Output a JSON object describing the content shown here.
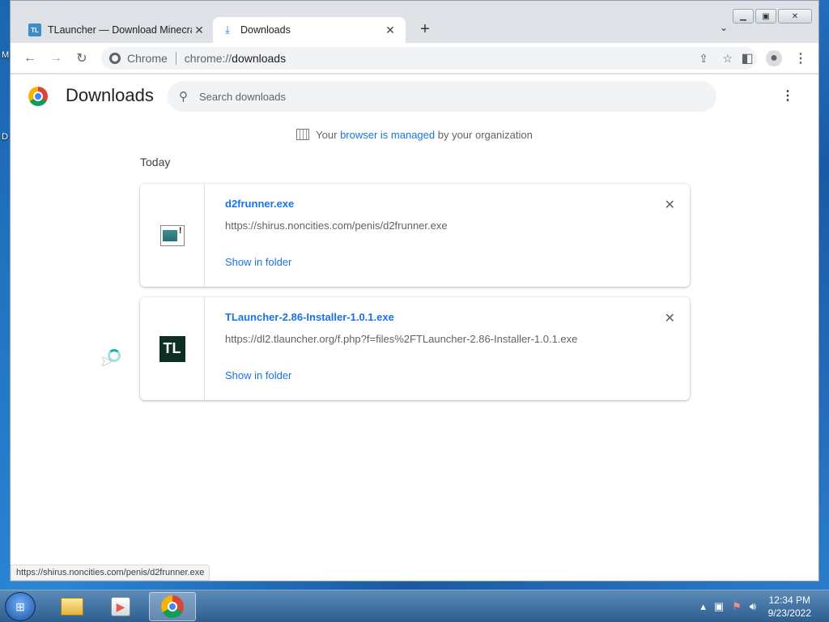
{
  "desktop": {
    "edge_letters": [
      "M",
      "D"
    ]
  },
  "browser": {
    "tabs": [
      {
        "title": "TLauncher — Download Minecra",
        "favicon": "tlauncher-icon",
        "active": false
      },
      {
        "title": "Downloads",
        "favicon": "download-icon",
        "active": true
      }
    ],
    "new_tab": "+",
    "tab_search": "⌄",
    "address": {
      "site_label": "Chrome",
      "url_scheme": "chrome://",
      "url_rest": "downloads"
    },
    "window_controls": [
      "minimize",
      "maximize",
      "close"
    ]
  },
  "page": {
    "title": "Downloads",
    "search_placeholder": "Search downloads",
    "managed_prefix": "Your ",
    "managed_link": "browser is managed",
    "managed_suffix": " by your organization",
    "section": "Today",
    "downloads": [
      {
        "filename": "d2frunner.exe",
        "url": "https://shirus.noncities.com/penis/d2frunner.exe",
        "action": "Show in folder",
        "icon": "exe-file-icon"
      },
      {
        "filename": "TLauncher-2.86-Installer-1.0.1.exe",
        "url": "https://dl2.tlauncher.org/f.php?f=files%2FTLauncher-2.86-Installer-1.0.1.exe",
        "action": "Show in folder",
        "icon": "tlauncher-app-icon",
        "icon_text": "TL"
      }
    ],
    "status_url": "https://shirus.noncities.com/penis/d2frunner.exe"
  },
  "taskbar": {
    "clock_time": "12:34 PM",
    "clock_date": "9/23/2022"
  },
  "colors": {
    "link": "#1a73e8",
    "tab_strip": "#dee1e6",
    "taskbar": "#2e5e8f"
  }
}
